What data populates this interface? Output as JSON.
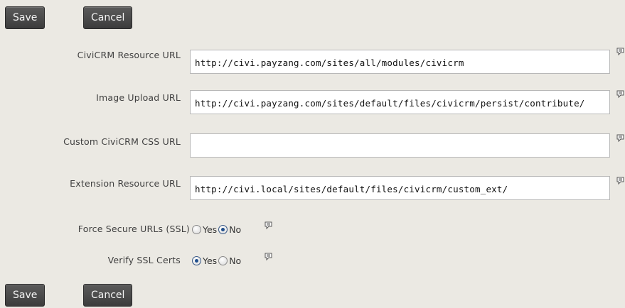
{
  "top_buttons": {
    "save": "Save",
    "cancel": "Cancel"
  },
  "bottom_buttons": {
    "save": "Save",
    "cancel": "Cancel"
  },
  "fields": [
    {
      "label": "CiviCRM Resource URL",
      "value": "http://civi.payzang.com/sites/all/modules/civicrm"
    },
    {
      "label": "Image Upload URL",
      "value": "http://civi.payzang.com/sites/default/files/civicrm/persist/contribute/"
    },
    {
      "label": "Custom CiviCRM CSS URL",
      "value": ""
    },
    {
      "label": "Extension Resource URL",
      "value": "http://civi.local/sites/default/files/civicrm/custom_ext/"
    }
  ],
  "force_ssl": {
    "label": "Force Secure URLs (SSL)",
    "yes": "Yes",
    "no": "No",
    "selected": "No"
  },
  "verify_ssl": {
    "label": "Verify SSL Certs",
    "yes": "Yes",
    "no": "No",
    "selected": "Yes"
  },
  "icons": {
    "help": "help-balloon-icon"
  }
}
